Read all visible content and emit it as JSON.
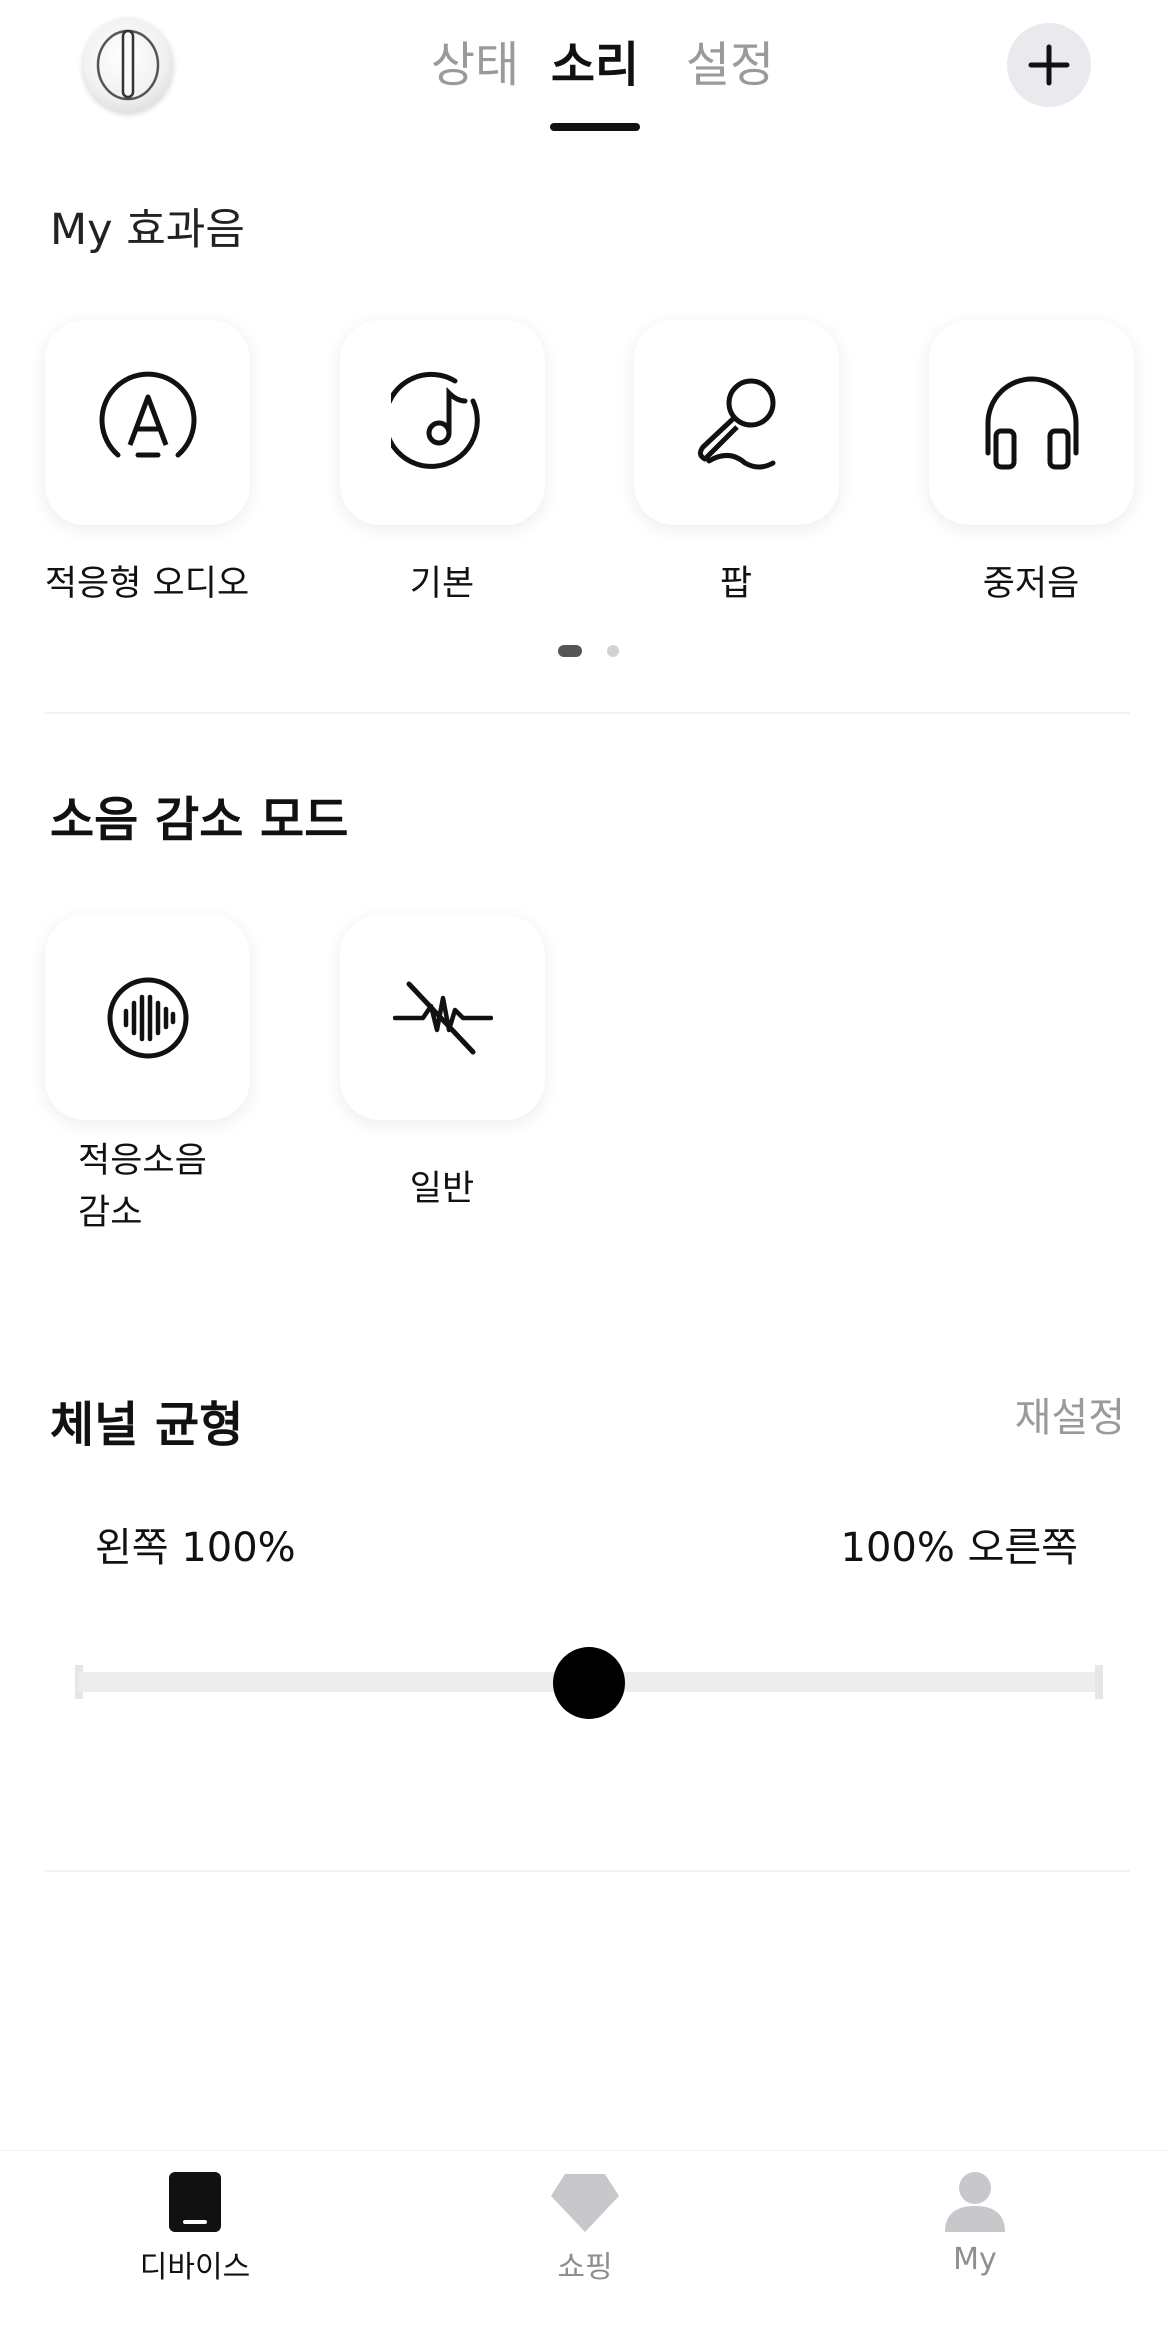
{
  "header": {
    "tabs": [
      {
        "label": "상태",
        "active": false
      },
      {
        "label": "소리",
        "active": true
      },
      {
        "label": "설정",
        "active": false
      }
    ],
    "add_icon": "plus-icon"
  },
  "effects": {
    "title": "My 효과음",
    "items": [
      {
        "label": "적응형 오디오",
        "icon": "adaptive-audio-icon"
      },
      {
        "label": "기본",
        "icon": "music-note-disc-icon"
      },
      {
        "label": "팝",
        "icon": "microphone-icon"
      },
      {
        "label": "중저음",
        "icon": "headphones-icon"
      }
    ],
    "page": 1,
    "pages": 2
  },
  "noise": {
    "title": "소음 감소 모드",
    "items": [
      {
        "label_line1": "적응소음",
        "label_line2": "감소",
        "icon": "sound-wave-circle-icon"
      },
      {
        "label_line1": "일반",
        "label_line2": "",
        "icon": "noise-off-icon"
      }
    ]
  },
  "balance": {
    "title": "체널 균형",
    "reset": "재설정",
    "left_text": "왼쪽 100%",
    "right_text": "100% 오른쪽",
    "value": 0.5
  },
  "bottom_nav": [
    {
      "label": "디바이스",
      "icon": "device-icon",
      "active": true
    },
    {
      "label": "쇼핑",
      "icon": "diamond-icon",
      "active": false
    },
    {
      "label": "My",
      "icon": "person-icon",
      "active": false
    }
  ],
  "colors": {
    "accent": "#111111",
    "inactive": "#9a9a9a",
    "nav_inactive": "#c8c8cc"
  }
}
